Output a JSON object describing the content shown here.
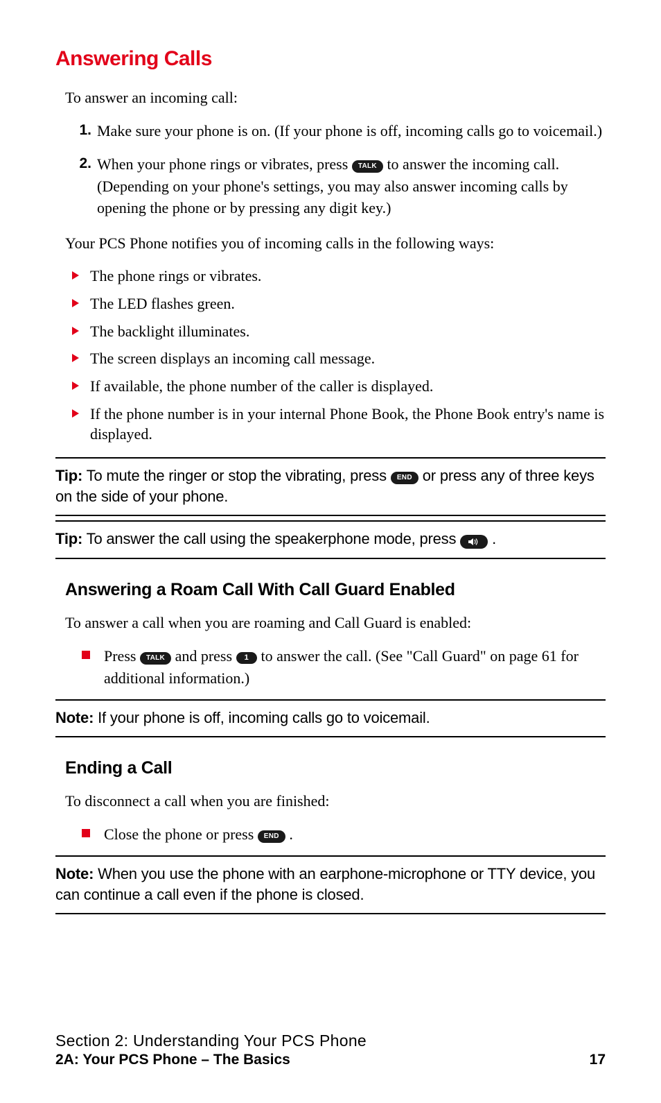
{
  "heading": "Answering Calls",
  "intro": "To answer an incoming call:",
  "steps": {
    "m1": "1.",
    "s1": "Make sure your phone is on. (If your phone is off, incoming calls go to voicemail.)",
    "m2": "2.",
    "s2a": "When your phone rings or vibrates, press ",
    "s2key": "TALK",
    "s2b": " to answer the incoming call. (Depending on your phone's settings, you may also answer incoming calls by opening the phone or by pressing any digit key.)"
  },
  "notify_intro": "Your PCS Phone notifies you of incoming calls in the following ways:",
  "notify": [
    "The phone rings or vibrates.",
    "The LED flashes green.",
    "The backlight illuminates.",
    "The screen displays an incoming call message.",
    "If available, the phone number of the caller is displayed.",
    "If the phone number is in your internal Phone Book, the Phone Book entry's name is displayed."
  ],
  "tip1": {
    "label": "Tip:",
    "a": " To mute the ringer or stop the vibrating, press ",
    "key": "END",
    "b": " or press any of three keys on the side of your phone."
  },
  "tip2": {
    "label": "Tip:",
    "a": " To answer the call using the speakerphone mode, press ",
    "b": " ."
  },
  "roam": {
    "heading": "Answering a Roam Call With Call Guard Enabled",
    "intro": "To answer a call when you are roaming and Call Guard is enabled:",
    "a": "Press ",
    "k1": "TALK",
    "b": " and press ",
    "k2": "1",
    "c": " to answer the call. (See \"Call Guard\" on page 61 for additional information.)"
  },
  "note1": {
    "label": "Note:",
    "text": " If your phone is off, incoming calls go to voicemail."
  },
  "ending": {
    "heading": "Ending a Call",
    "intro": "To disconnect a call when you are finished:",
    "a": "Close the phone or press ",
    "key": "END",
    "b": " ."
  },
  "note2": {
    "label": "Note:",
    "text": " When you use the phone with an earphone-microphone or TTY device, you can continue a call even if the phone is closed."
  },
  "footer": {
    "section": "Section 2: Understanding Your PCS Phone",
    "sub": "2A: Your PCS Phone – The Basics",
    "page": "17"
  }
}
